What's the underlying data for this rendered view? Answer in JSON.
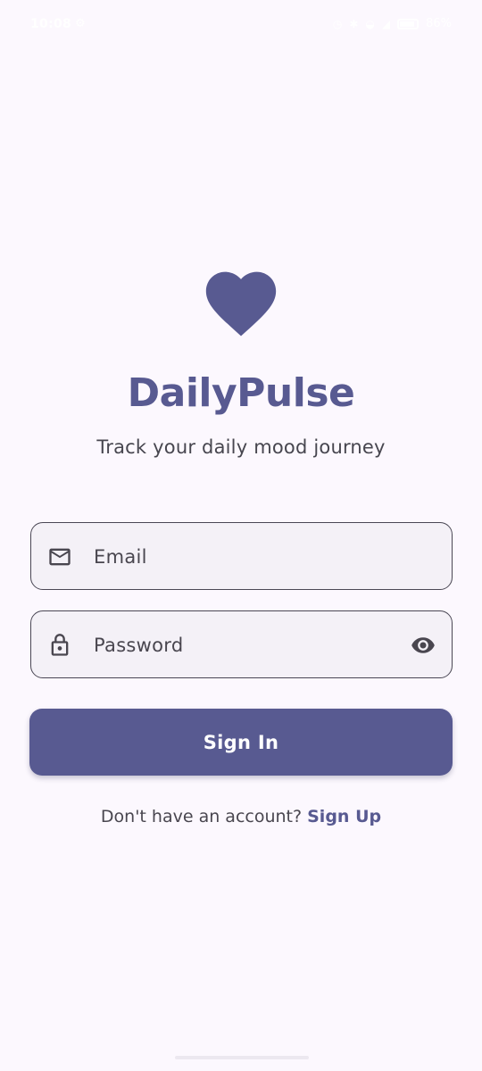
{
  "status_bar": {
    "time": "10:08",
    "battery_text": "86%"
  },
  "app": {
    "title": "DailyPulse",
    "subtitle": "Track your daily mood journey",
    "brand_color": "#585a91",
    "logo_icon": "heart-icon"
  },
  "form": {
    "email": {
      "placeholder": "Email",
      "icon": "mail-icon",
      "value": ""
    },
    "password": {
      "placeholder": "Password",
      "icon": "lock-icon",
      "value": "",
      "toggle_icon": "eye-icon"
    },
    "submit_label": "Sign In"
  },
  "signup": {
    "prompt": "Don't have an account?",
    "link_label": "Sign Up"
  }
}
